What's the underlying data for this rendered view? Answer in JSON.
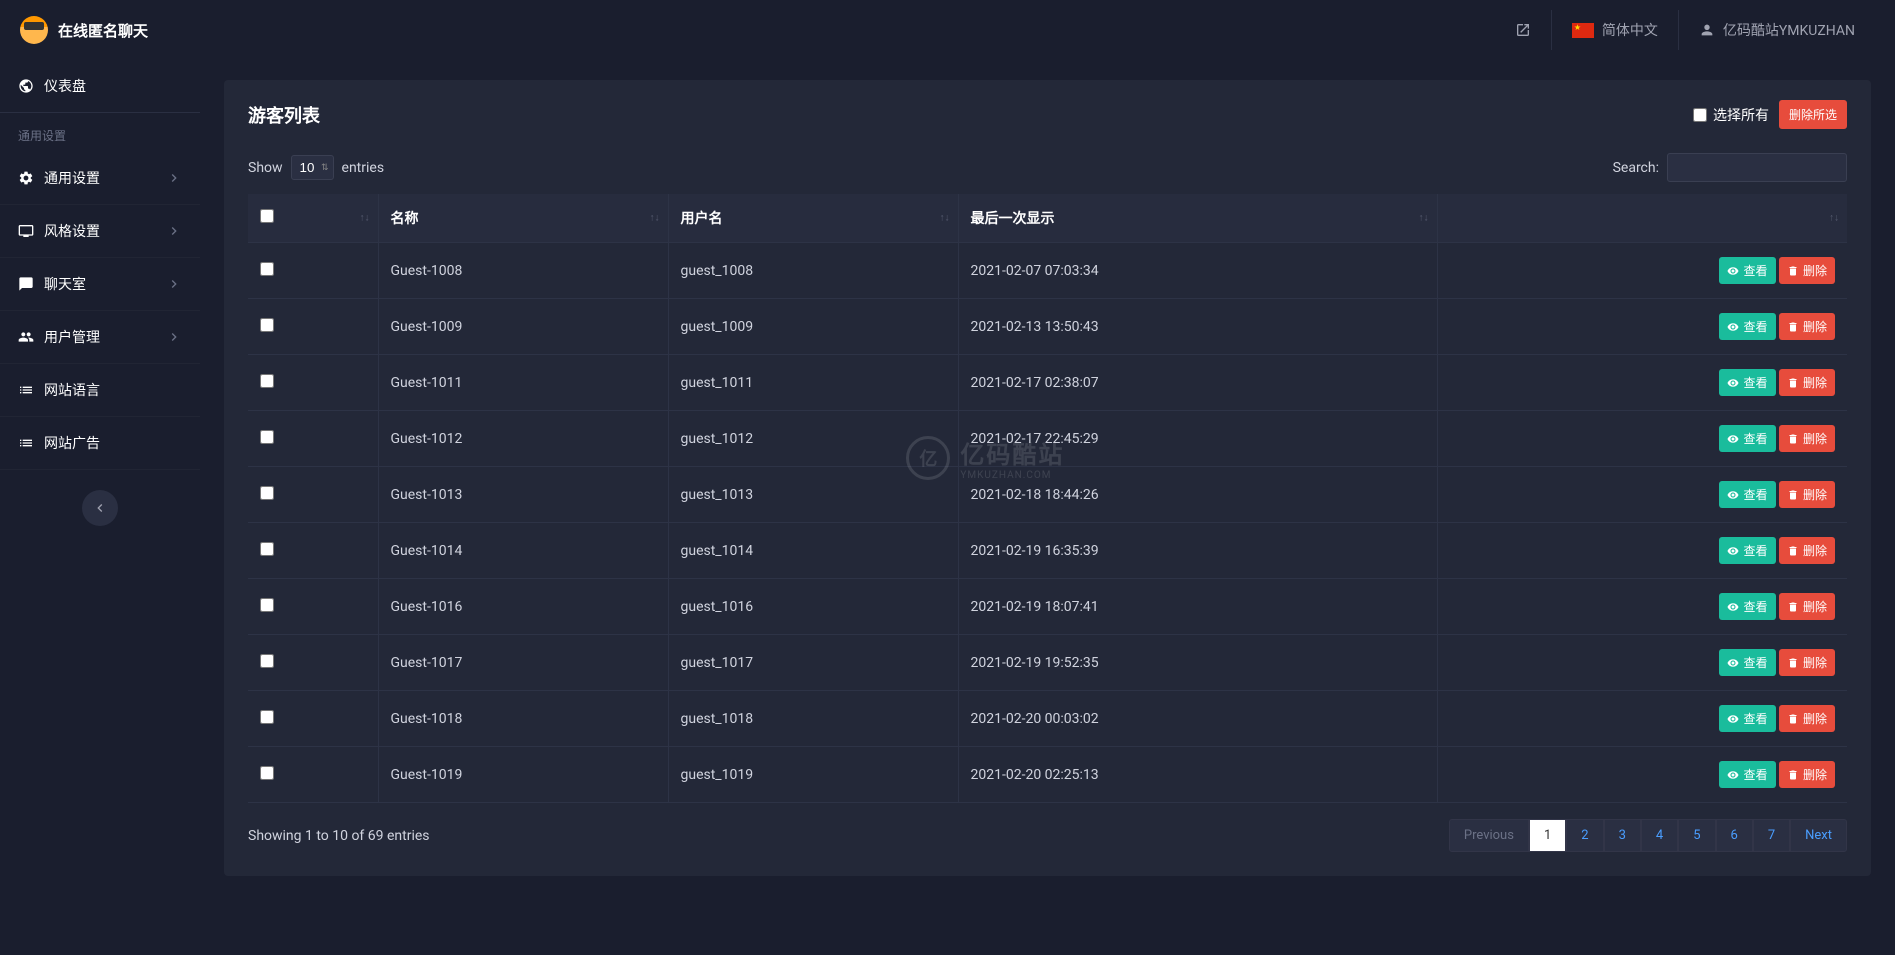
{
  "brand": "在线匿名聊天",
  "topbar": {
    "lang": "简体中文",
    "user": "亿码酷站YMKUZHAN"
  },
  "sidebar": {
    "dashboard": "仪表盘",
    "section_general": "通用设置",
    "items": [
      {
        "label": "通用设置",
        "icon": "gear",
        "expandable": true
      },
      {
        "label": "风格设置",
        "icon": "monitor",
        "expandable": true
      },
      {
        "label": "聊天室",
        "icon": "chat",
        "expandable": true
      },
      {
        "label": "用户管理",
        "icon": "users",
        "expandable": true
      },
      {
        "label": "网站语言",
        "icon": "list",
        "expandable": false
      },
      {
        "label": "网站广告",
        "icon": "list",
        "expandable": false
      }
    ]
  },
  "page": {
    "title": "游客列表",
    "select_all_label": "选择所有",
    "delete_selected": "删除所选"
  },
  "table": {
    "show_label": "Show",
    "entries_label": "entries",
    "page_size": "10",
    "search_label": "Search:",
    "headers": {
      "name": "名称",
      "username": "用户名",
      "last_seen": "最后一次显示"
    },
    "actions": {
      "view": "查看",
      "delete": "删除"
    },
    "rows": [
      {
        "name": "Guest-1008",
        "username": "guest_1008",
        "last_seen": "2021-02-07 07:03:34"
      },
      {
        "name": "Guest-1009",
        "username": "guest_1009",
        "last_seen": "2021-02-13 13:50:43"
      },
      {
        "name": "Guest-1011",
        "username": "guest_1011",
        "last_seen": "2021-02-17 02:38:07"
      },
      {
        "name": "Guest-1012",
        "username": "guest_1012",
        "last_seen": "2021-02-17 22:45:29"
      },
      {
        "name": "Guest-1013",
        "username": "guest_1013",
        "last_seen": "2021-02-18 18:44:26"
      },
      {
        "name": "Guest-1014",
        "username": "guest_1014",
        "last_seen": "2021-02-19 16:35:39"
      },
      {
        "name": "Guest-1016",
        "username": "guest_1016",
        "last_seen": "2021-02-19 18:07:41"
      },
      {
        "name": "Guest-1017",
        "username": "guest_1017",
        "last_seen": "2021-02-19 19:52:35"
      },
      {
        "name": "Guest-1018",
        "username": "guest_1018",
        "last_seen": "2021-02-20 00:03:02"
      },
      {
        "name": "Guest-1019",
        "username": "guest_1019",
        "last_seen": "2021-02-20 02:25:13"
      }
    ],
    "footer_info": "Showing 1 to 10 of 69 entries",
    "pagination": {
      "prev": "Previous",
      "next": "Next",
      "pages": [
        "1",
        "2",
        "3",
        "4",
        "5",
        "6",
        "7"
      ],
      "current": "1"
    }
  },
  "watermark": {
    "main": "亿码酷站",
    "sub": "YMKUZHAN.COM"
  }
}
